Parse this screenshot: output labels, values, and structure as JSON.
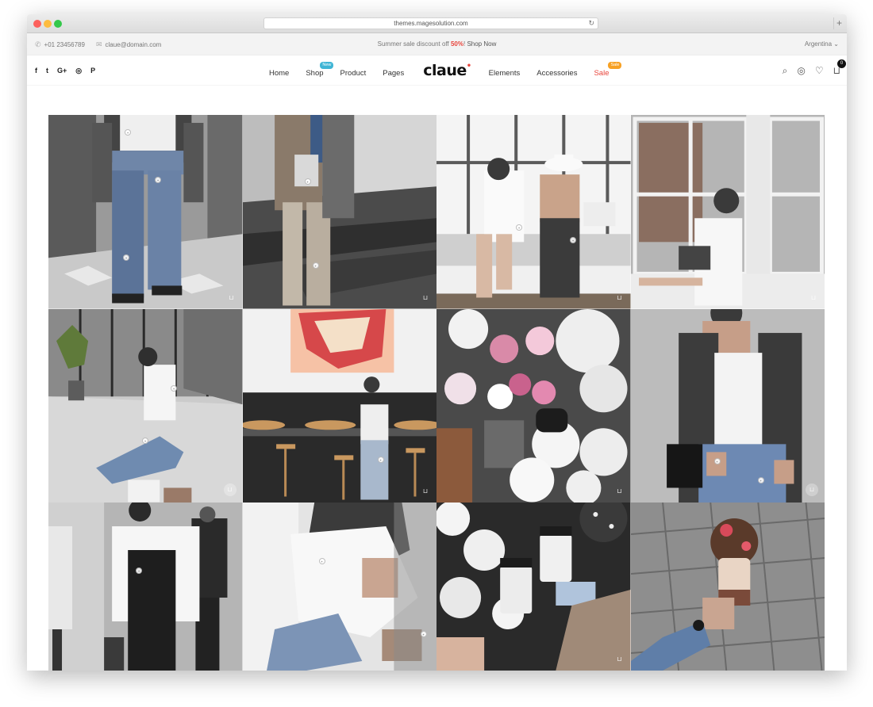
{
  "browser": {
    "url": "themes.magesolution.com",
    "reload_icon": "reload-icon",
    "new_tab_icon": "plus-icon"
  },
  "topbar": {
    "phone": "+01 23456789",
    "email": "claue@domain.com",
    "promo_prefix": "Summer sale discount off ",
    "promo_percent": "50%",
    "promo_suffix": "! ",
    "promo_link": "Shop Now",
    "country": "Argentina"
  },
  "header": {
    "social": [
      "f",
      "t",
      "G+",
      "◎",
      "P"
    ],
    "nav": {
      "home": "Home",
      "shop": "Shop",
      "shop_badge": "New",
      "product": "Product",
      "pages": "Pages",
      "logo": "claue",
      "elements": "Elements",
      "accessories": "Accessories",
      "sale": "Sale",
      "sale_badge": "Sale"
    },
    "cart_count": "0"
  },
  "colors": {
    "accent": "#e8453c",
    "badge_new": "#3fb5d5",
    "badge_sale": "#f7a124"
  },
  "gallery": {
    "tiles": 12,
    "bag_icon": "shopping-bag-icon",
    "hotspot_icon": "hotspot-marker-icon"
  }
}
